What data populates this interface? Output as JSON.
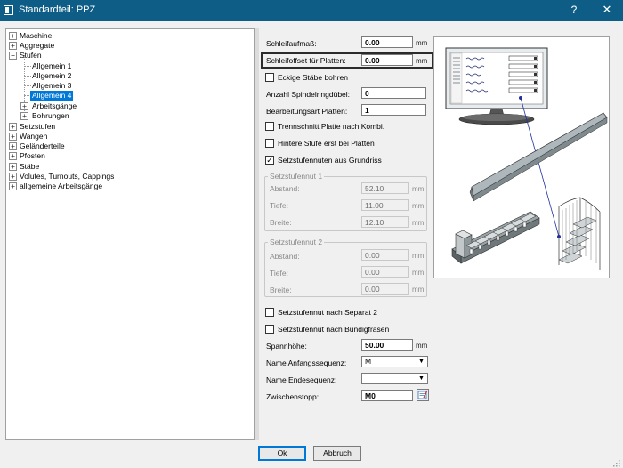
{
  "window": {
    "title": "Standardteil: PPZ",
    "help_label": "?",
    "close_label": "✕",
    "icon": "window-icon"
  },
  "tree": {
    "items": [
      {
        "label": "Maschine",
        "expander": "+"
      },
      {
        "label": "Aggregate",
        "expander": "+"
      },
      {
        "label": "Stufen",
        "expander": "−"
      },
      {
        "label": "Allgemein  1"
      },
      {
        "label": "Allgemein  2"
      },
      {
        "label": "Allgemein  3"
      },
      {
        "label": "Allgemein  4",
        "selected": true
      },
      {
        "label": "Arbeitsgänge",
        "expander": "+"
      },
      {
        "label": "Bohrungen",
        "expander": "+"
      },
      {
        "label": "Setzstufen",
        "expander": "+"
      },
      {
        "label": "Wangen",
        "expander": "+"
      },
      {
        "label": "Geländerteile",
        "expander": "+"
      },
      {
        "label": "Pfosten",
        "expander": "+"
      },
      {
        "label": "Stäbe",
        "expander": "+"
      },
      {
        "label": "Volutes, Turnouts, Cappings",
        "expander": "+"
      },
      {
        "label": "allgemeine Arbeitsgänge",
        "expander": "+"
      }
    ]
  },
  "form": {
    "schleifaufmass": {
      "label": "Schleifaufmaß:",
      "value": "0.00",
      "unit": "mm"
    },
    "schleifoffset": {
      "label": "Schleifoffset für Platten:",
      "value": "0.00",
      "unit": "mm"
    },
    "eckige_staebe": {
      "label": "Eckige Stäbe bohren",
      "checked": false
    },
    "spindelringduebel": {
      "label": "Anzahl Spindelringdübel:",
      "value": "0"
    },
    "bearbeitungsart": {
      "label": "Bearbeitungsart Platten:",
      "value": "1"
    },
    "trennschnitt": {
      "label": "Trennschnitt Platte nach Kombi.",
      "checked": false
    },
    "hintere_stufe": {
      "label": "Hintere Stufe erst bei Platten",
      "checked": false
    },
    "setzstufennuten_grundriss": {
      "label": "Setzstufennuten aus Grundriss",
      "checked": true,
      "mark": "✓"
    },
    "nut1": {
      "title": "Setzstufennut 1",
      "abstand": {
        "label": "Abstand:",
        "value": "52.10",
        "unit": "mm"
      },
      "tiefe": {
        "label": "Tiefe:",
        "value": "11.00",
        "unit": "mm"
      },
      "breite": {
        "label": "Breite:",
        "value": "12.10",
        "unit": "mm"
      }
    },
    "nut2": {
      "title": "Setzstufennut 2",
      "abstand": {
        "label": "Abstand:",
        "value": "0.00",
        "unit": "mm"
      },
      "tiefe": {
        "label": "Tiefe:",
        "value": "0.00",
        "unit": "mm"
      },
      "breite": {
        "label": "Breite:",
        "value": "0.00",
        "unit": "mm"
      }
    },
    "nut_separat2": {
      "label": "Setzstufennut nach Separat 2",
      "checked": false
    },
    "nut_buendigfraesen": {
      "label": "Setzstufennut nach Bündigfräsen",
      "checked": false
    },
    "spannhoehe": {
      "label": "Spannhöhe:",
      "value": "50.00",
      "unit": "mm"
    },
    "anfangssequenz": {
      "label": "Name Anfangssequenz:",
      "value": "M"
    },
    "endesequenz": {
      "label": "Name Endesequenz:",
      "value": ""
    },
    "zwischenstopp": {
      "label": "Zwischenstopp:",
      "value": "M0"
    }
  },
  "buttons": {
    "ok": "Ok",
    "cancel": "Abbruch"
  },
  "colors": {
    "titlebar": "#0d5d86",
    "selection": "#0078d7"
  }
}
